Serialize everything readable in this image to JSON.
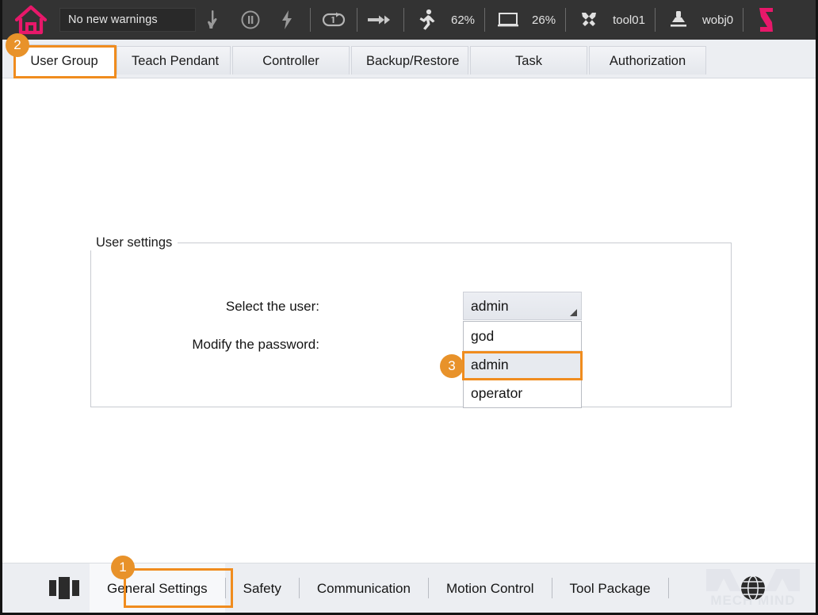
{
  "topbar": {
    "home_icon": "home-icon",
    "warning_text": "No new warnings",
    "icons": [
      {
        "name": "hand-pointer-icon"
      },
      {
        "name": "pause-circle-icon"
      },
      {
        "name": "lightning-bolt-icon"
      }
    ],
    "loop_icon": "loop-once-icon",
    "forward_icon": "fast-forward-icon",
    "speed": {
      "icon": "running-man-icon",
      "value": "62%"
    },
    "screen": {
      "icon": "monitor-icon",
      "value": "26%"
    },
    "tool": {
      "icon": "tools-icon",
      "value": "tool01"
    },
    "workobject": {
      "icon": "workobject-icon",
      "value": "wobj0"
    },
    "robot_icon": "robot-arm-icon"
  },
  "tabs": [
    {
      "label": "User Group",
      "active": true
    },
    {
      "label": "Teach Pendant",
      "active": false
    },
    {
      "label": "Controller",
      "active": false
    },
    {
      "label": "Backup/Restore",
      "active": false
    },
    {
      "label": "Task",
      "active": false
    },
    {
      "label": "Authorization",
      "active": false
    }
  ],
  "main": {
    "group_title": "User settings",
    "select_user_label": "Select the user:",
    "modify_password_label": "Modify the password:",
    "user_combo": {
      "value": "admin",
      "options": [
        "god",
        "admin",
        "operator"
      ],
      "selected_index": 1,
      "open": true
    }
  },
  "bottombar": {
    "panels_icon": "panels-layout-icon",
    "items": [
      {
        "label": "General Settings",
        "active": true
      },
      {
        "label": "Safety",
        "active": false
      },
      {
        "label": "Communication",
        "active": false
      },
      {
        "label": "Motion Control",
        "active": false
      },
      {
        "label": "Tool Package",
        "active": false
      }
    ],
    "globe_icon": "globe-icon",
    "watermark": "MECH MIND"
  },
  "annotations": [
    {
      "badge": "1",
      "target": "General Settings"
    },
    {
      "badge": "2",
      "target": "User Group"
    },
    {
      "badge": "3",
      "target": "admin"
    }
  ],
  "colors": {
    "accent_orange": "#F08C1E",
    "badge_orange": "#E8922A",
    "topbar_bg": "#333333",
    "brand_pink": "#E8186A"
  }
}
